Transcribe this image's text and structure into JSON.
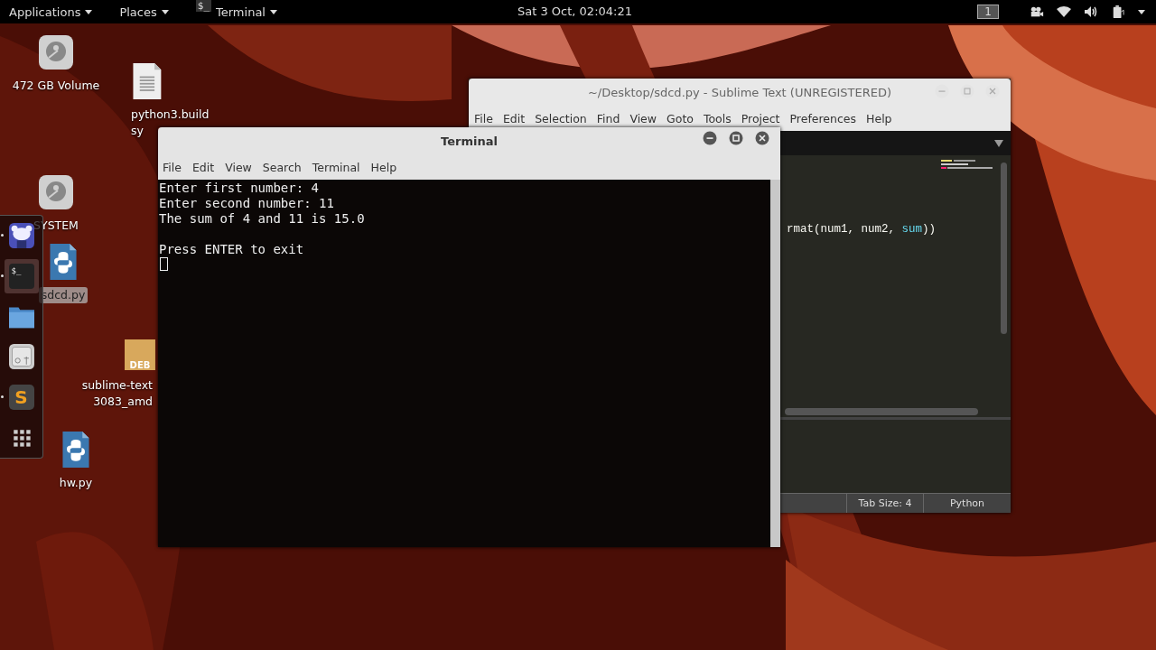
{
  "top_bar": {
    "menus": [
      {
        "label": "Applications"
      },
      {
        "label": "Places"
      },
      {
        "label": "Terminal",
        "glyph": "$_"
      }
    ],
    "clock": "Sat  3 Oct, 02:04:21",
    "workspace": "1"
  },
  "desktop_icons": [
    {
      "kind": "drive",
      "lines": [
        "472 GB Volume"
      ],
      "selected": false
    },
    {
      "kind": "document",
      "lines": [
        "python3.build",
        "sy"
      ],
      "selected": false
    },
    {
      "kind": "drive",
      "lines": [
        "SYSTEM"
      ],
      "selected": false
    },
    {
      "kind": "python",
      "lines": [
        "sdcd.py"
      ],
      "selected": true
    },
    {
      "kind": "package",
      "badge": "DEB",
      "lines": [
        "sublime-text",
        "3083_amd"
      ],
      "selected": false
    },
    {
      "kind": "python",
      "lines": [
        "hw.py"
      ],
      "selected": false
    }
  ],
  "dock": {
    "items": [
      {
        "kind": "chat",
        "running": true,
        "selected": false
      },
      {
        "kind": "terminal",
        "glyph": "$_",
        "running": true,
        "selected": true
      },
      {
        "kind": "files",
        "running": false,
        "selected": false
      },
      {
        "kind": "settings",
        "running": false,
        "selected": false
      },
      {
        "kind": "editor",
        "glyph": "S",
        "running": true,
        "selected": false
      },
      {
        "kind": "apps",
        "running": false,
        "selected": false
      }
    ]
  },
  "sublime": {
    "title": "~/Desktop/sdcd.py - Sublime Text (UNREGISTERED)",
    "menu": [
      "File",
      "Edit",
      "Selection",
      "Find",
      "View",
      "Goto",
      "Tools",
      "Project",
      "Preferences",
      "Help"
    ],
    "code": [
      {
        "tokens": [
          {
            "text": "rmat(num1, num2, ",
            "kind": "plain"
          },
          {
            "text": "sum",
            "kind": "builtin"
          },
          {
            "text": "))",
            "kind": "plain"
          }
        ]
      }
    ],
    "status": {
      "tab_size": "Tab Size: 4",
      "syntax": "Python"
    }
  },
  "terminal": {
    "title": "Terminal",
    "menu": [
      "File",
      "Edit",
      "View",
      "Search",
      "Terminal",
      "Help"
    ],
    "output_blocks": [
      [
        "Enter first number: 4",
        "Enter second number: 11",
        "The sum of 4 and 11 is 15.0"
      ],
      [
        "Press ENTER to exit"
      ]
    ],
    "cursor_visible": true
  }
}
